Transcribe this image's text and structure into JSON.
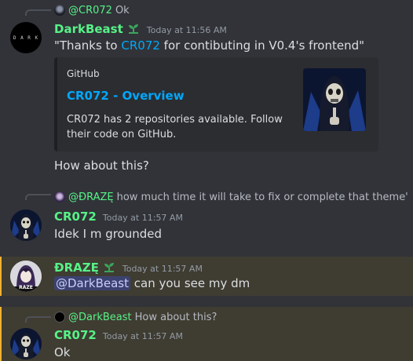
{
  "messages": [
    {
      "reply": {
        "name": "@CR072",
        "text": "Ok"
      },
      "author": "DarkBeast",
      "author_color": "#57f287",
      "timestamp": "Today at 11:56 AM",
      "quote_open": "\"Thanks to ",
      "quote_link": "CR072",
      "quote_rest": " for contibuting in V0.4's frontend\"",
      "embed": {
        "provider": "GitHub",
        "title": "CR072 - Overview",
        "description": "CR072 has 2 repositories available. Follow their code on GitHub."
      },
      "followup": "How about this?"
    },
    {
      "reply": {
        "name": "@ĐRAZĘ",
        "text": "how much time it will take to fix or complete that theme'"
      },
      "author": "CR072",
      "author_color": "#57f287",
      "timestamp": "Today at 11:57 AM",
      "text": "Idek I m grounded"
    },
    {
      "author": "ĐRAZĘ",
      "author_color": "#57f287",
      "timestamp": "Today at 11:57 AM",
      "mention": "@DarkBeast",
      "text": " can you see my dm"
    },
    {
      "reply": {
        "name": "@DarkBeast",
        "text": "How about this?"
      },
      "author": "CR072",
      "author_color": "#57f287",
      "timestamp": "Today at 11:57 AM",
      "text": "Ok"
    }
  ],
  "avatar_dark_label": "D A R K",
  "avatar_draze_label": "RAZE"
}
